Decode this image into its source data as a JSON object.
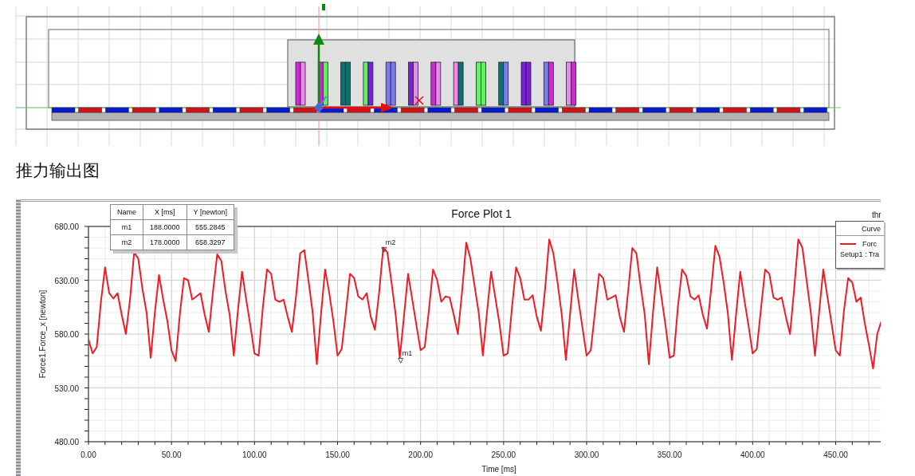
{
  "caption": "推力输出图",
  "plot": {
    "title": "Force Plot 1",
    "corner_text": "thr",
    "marker_table": {
      "columns": [
        "Name",
        "X [ms]",
        "Y [newton]"
      ],
      "rows": [
        [
          "m1",
          "188.0000",
          "555.2845"
        ],
        [
          "m2",
          "178.0000",
          "658.3297"
        ]
      ]
    },
    "legend": {
      "title": "Curve",
      "note": "Setup1 : Tra"
    },
    "chart_data": {
      "type": "line",
      "xlabel": "Time [ms]",
      "ylabel": "Force1.Force_x [newton]",
      "xlim": [
        0,
        480
      ],
      "ylim": [
        480,
        680
      ],
      "xticks": [
        {
          "value": 0,
          "label": "0.00"
        },
        {
          "value": 50,
          "label": "50.00"
        },
        {
          "value": 100,
          "label": "100.00"
        },
        {
          "value": 150,
          "label": "150.00"
        },
        {
          "value": 200,
          "label": "200.00"
        },
        {
          "value": 250,
          "label": "250.00"
        },
        {
          "value": 300,
          "label": "300.00"
        },
        {
          "value": 350,
          "label": "350.00"
        },
        {
          "value": 400,
          "label": "400.00"
        },
        {
          "value": 450,
          "label": "450.00"
        }
      ],
      "yticks": [
        {
          "value": 480,
          "label": "480.00"
        },
        {
          "value": 530,
          "label": "530.00"
        },
        {
          "value": 580,
          "label": "580.00"
        },
        {
          "value": 630,
          "label": "630.00"
        },
        {
          "value": 680,
          "label": "680.00"
        }
      ],
      "grid": true,
      "x": [
        0,
        2.5,
        5,
        7.5,
        10,
        12.5,
        15,
        17.5,
        20,
        22.5,
        25,
        27.5,
        30,
        32.5,
        35,
        37.5,
        40,
        42.5,
        45,
        47.5,
        50,
        52.5,
        55,
        57.5,
        60,
        62.5,
        65,
        67.5,
        70,
        72.5,
        75,
        77.5,
        80,
        82.5,
        85,
        87.5,
        90,
        92.5,
        95,
        97.5,
        100,
        102.5,
        105,
        107.5,
        110,
        112.5,
        115,
        117.5,
        120,
        122.5,
        125,
        127.5,
        130,
        132.5,
        135,
        137.5,
        140,
        142.5,
        145,
        147.5,
        150,
        152.5,
        155,
        157.5,
        160,
        162.5,
        165,
        167.5,
        170,
        172.5,
        175,
        177.5,
        180,
        182.5,
        185,
        187.5,
        190,
        192.5,
        195,
        197.5,
        200,
        202.5,
        205,
        207.5,
        210,
        212.5,
        215,
        217.5,
        220,
        222.5,
        225,
        227.5,
        230,
        232.5,
        235,
        237.5,
        240,
        242.5,
        245,
        247.5,
        250,
        252.5,
        255,
        257.5,
        260,
        262.5,
        265,
        267.5,
        270,
        272.5,
        275,
        277.5,
        280,
        282.5,
        285,
        287.5,
        290,
        292.5,
        295,
        297.5,
        300,
        302.5,
        305,
        307.5,
        310,
        312.5,
        315,
        317.5,
        320,
        322.5,
        325,
        327.5,
        330,
        332.5,
        335,
        337.5,
        340,
        342.5,
        345,
        347.5,
        350,
        352.5,
        355,
        357.5,
        360,
        362.5,
        365,
        367.5,
        370,
        372.5,
        375,
        377.5,
        380,
        382.5,
        385,
        387.5,
        390,
        392.5,
        395,
        397.5,
        400,
        402.5,
        405,
        407.5,
        410,
        412.5,
        415,
        417.5,
        420,
        422.5,
        425,
        427.5,
        430,
        432.5,
        435,
        437.5,
        440,
        442.5,
        445,
        447.5,
        450,
        452.5,
        455,
        457.5,
        460,
        462.5,
        465,
        467.5,
        470,
        472.5,
        475,
        477.5
      ],
      "series": [
        {
          "name": "Forc",
          "color": "#ee1c25",
          "values": [
            575,
            562,
            568,
            610,
            642,
            618,
            613,
            618,
            598,
            580,
            612,
            656,
            650,
            622,
            600,
            558,
            600,
            635,
            612,
            592,
            565,
            555,
            598,
            632,
            630,
            612,
            615,
            618,
            598,
            582,
            620,
            654,
            648,
            620,
            598,
            560,
            602,
            638,
            612,
            588,
            562,
            560,
            605,
            640,
            636,
            612,
            610,
            612,
            596,
            582,
            615,
            655,
            658,
            630,
            600,
            552,
            598,
            640,
            618,
            592,
            560,
            566,
            600,
            636,
            632,
            615,
            612,
            618,
            596,
            584,
            618,
            660,
            656,
            628,
            598,
            558,
            596,
            636,
            612,
            588,
            565,
            568,
            602,
            640,
            630,
            610,
            615,
            614,
            598,
            580,
            620,
            665,
            650,
            625,
            600,
            560,
            600,
            638,
            614,
            590,
            560,
            562,
            604,
            642,
            632,
            612,
            612,
            616,
            596,
            583,
            622,
            668,
            655,
            628,
            598,
            556,
            598,
            640,
            612,
            586,
            560,
            565,
            600,
            636,
            632,
            612,
            614,
            616,
            596,
            582,
            620,
            660,
            655,
            625,
            598,
            552,
            600,
            642,
            615,
            588,
            558,
            560,
            606,
            640,
            634,
            615,
            612,
            616,
            598,
            585,
            622,
            662,
            652,
            628,
            600,
            556,
            598,
            638,
            612,
            588,
            562,
            566,
            604,
            640,
            636,
            614,
            612,
            614,
            596,
            580,
            622,
            668,
            660,
            630,
            600,
            560,
            600,
            640,
            615,
            590,
            565,
            560,
            602,
            632,
            628,
            610,
            614,
            590,
            570,
            548,
            580,
            592
          ]
        }
      ],
      "annotations": [
        {
          "text": "m1",
          "x": 188,
          "y": 555.2845
        },
        {
          "text": "m2",
          "x": 178,
          "y": 658.3297
        }
      ]
    }
  }
}
